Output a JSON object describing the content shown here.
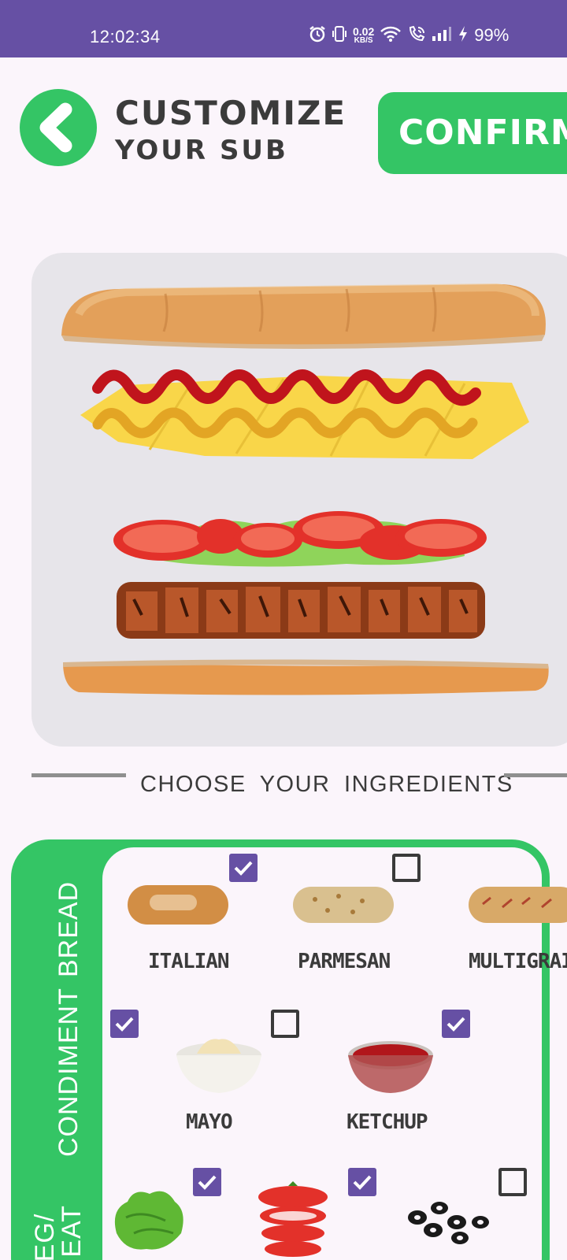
{
  "status_bar": {
    "time": "12:02:34",
    "net_speed_value": "0.02",
    "net_speed_unit": "KB/S",
    "battery": "99%",
    "icons": [
      "alarm-icon",
      "vibrate-icon",
      "wifi-icon",
      "wifi-call-icon",
      "signal-icon",
      "charging-icon"
    ]
  },
  "header": {
    "back_icon": "chevron-left-icon",
    "title_line1": "CUSTOMIZE",
    "title_line2": "YOUR SUB",
    "confirm_label": "CONFIRM"
  },
  "preview": {
    "layers": [
      "top-bread",
      "ketchup-mustard-cheese",
      "tomato-lettuce",
      "grilled-meat",
      "bottom-bread"
    ]
  },
  "section_title": "CHOOSE  YOUR  INGREDIENTS",
  "categories": {
    "bread": {
      "label": "BREAD",
      "items": [
        {
          "name": "ITALIAN",
          "checked": true
        },
        {
          "name": "PARMESAN",
          "checked": false
        },
        {
          "name": "MULTIGRAIN",
          "checked": false
        }
      ]
    },
    "condiment": {
      "label": "CONDIMENT",
      "items": [
        {
          "name": "",
          "checked": true
        },
        {
          "name": "MAYO",
          "checked": false
        },
        {
          "name": "KETCHUP",
          "checked": true
        }
      ]
    },
    "veg_meat": {
      "label_line1": "VEG/",
      "label_line2": "MEAT",
      "items": [
        {
          "name": "lettuce",
          "checked": true
        },
        {
          "name": "tomato",
          "checked": true
        },
        {
          "name": "olives",
          "checked": false
        }
      ]
    }
  },
  "colors": {
    "primary_green": "#34c565",
    "status_purple": "#6650a4",
    "checkbox_purple": "#6650a4",
    "text_dark": "#3b3b3b",
    "background": "#fbf5fb"
  }
}
